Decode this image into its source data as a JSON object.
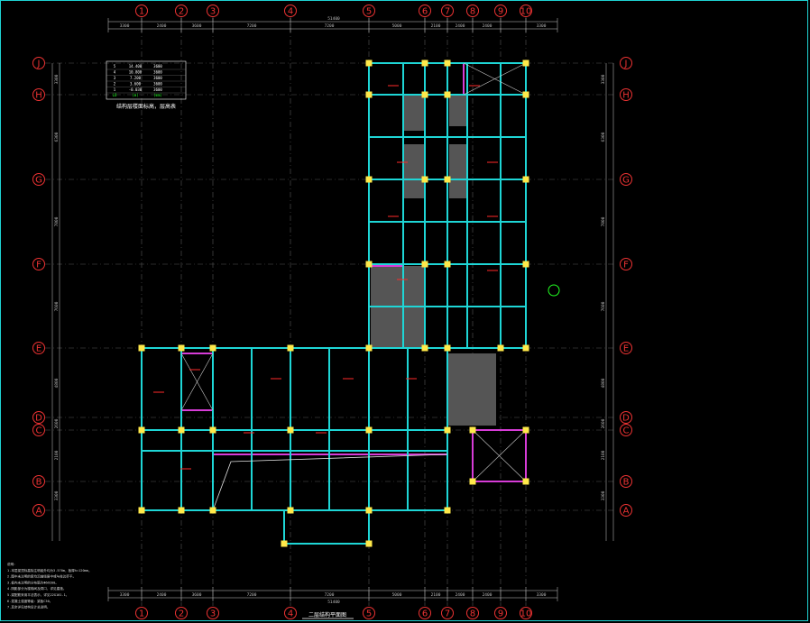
{
  "axes_x": [
    "1",
    "2",
    "3",
    "4",
    "5",
    "6",
    "7",
    "8",
    "9",
    "10"
  ],
  "axes_y": [
    "J",
    "H",
    "G",
    "F",
    "E",
    "D",
    "C",
    "B",
    "A"
  ],
  "dims_top_total": "51400",
  "dims_top": [
    "3300",
    "2400",
    "3600",
    "7200",
    "7200",
    "5000",
    "2100",
    "2400",
    "2400",
    "3300"
  ],
  "dims_bottom_total": "51400",
  "dims_left": [
    "3300",
    "6300",
    "7800",
    "7600",
    "4800",
    "2600",
    "2100",
    "3300"
  ],
  "legend_rows": [
    [
      "5",
      "14.400",
      "3600"
    ],
    [
      "4",
      "10.800",
      "3600"
    ],
    [
      "3",
      "7.200",
      "3600"
    ],
    [
      "2",
      "3.600",
      "3600"
    ],
    [
      "1",
      "-0.030",
      "3600"
    ]
  ],
  "legend_header": [
    "LO",
    "(m)",
    "(mm)"
  ],
  "legend_caption": "结构层楼面标高，层高表",
  "drawing_title": "二层结构平面图",
  "notes": [
    "说明：",
    "1.本层梁顶标高除注明者外均为3.570m，板厚h=120mm。",
    "2.图中未注明的梁均沿轴线居中或与柱边齐平。",
    "3.板内未注明的分布筋为Φ6@200。",
    "4.阴影部分为楼梯间及洞口，详见建施。",
    "5.梁配筋采用平法表示，详见22G101-1。",
    "6.混凝土强度等级：梁板C30。",
    "7.其余详见结构设计总说明。"
  ]
}
